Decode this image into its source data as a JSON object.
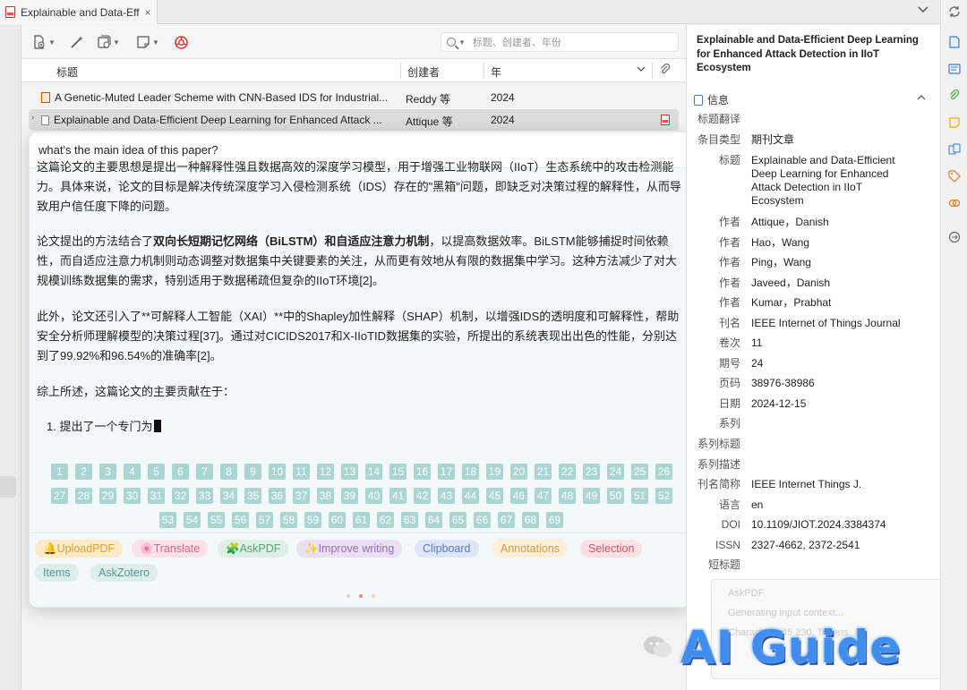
{
  "tab": {
    "title": "Explainable and Data-Eff",
    "close": "×"
  },
  "search": {
    "placeholder": "标题、创建者、年份"
  },
  "columns": {
    "title": "标题",
    "creator": "创建者",
    "year": "年"
  },
  "rows": [
    {
      "title": "A Genetic-Muted Leader Scheme with CNN-Based IDS for Industrial...",
      "creator": "Reddy 等",
      "year": "2024"
    },
    {
      "title": "Explainable and Data-Efficient Deep Learning for Enhanced Attack ...",
      "creator": "Attique 等",
      "year": "2024"
    }
  ],
  "chat": {
    "question": "what's the main idea of this paper?",
    "p0": "这篇论文的主要思想是提出一种解释性强且数据高效的深度学习模型，用于增强工业物联网（IIoT）生态系统中的攻击检测能",
    "p1": "力。具体来说，论文的目标是解决传统深度学习入侵检测系统（IDS）存在的\"黑箱\"问题，即缺乏对决策过程的解释性，从而导致用户信任度下降的问题。",
    "p2_pre": "论文提出的方法结合了",
    "p2_bold": "双向长短期记忆网络（BiLSTM）和自适应注意力机制",
    "p2_post": "，以提高数据效率。BiLSTM能够捕捉时间依赖性，而自适应注意力机制则动态调整对数据集中关键要素的关注，从而更有效地从有限的数据集中学习。这种方法减少了对大规模训练数据集的需求，特别适用于数据稀疏但复杂的IIoT环境[2]。",
    "p3": "此外，论文还引入了**可解释人工智能（XAI）**中的Shapley加性解释（SHAP）机制，以增强IDS的透明度和可解释性，帮助安全分析师理解模型的决策过程[37]。通过对CICIDS2017和X-IIoTID数据集的实验，所提出的系统表现出出色的性能，分别达到了99.92%和96.54%的准确率[2]。",
    "p4": "综上所述，这篇论文的主要贡献在于：",
    "p5": "1. 提出了一个专门为",
    "chips": [
      "🔔UploadPDF",
      "🌸Translate",
      "🧩AskPDF",
      "✨Improve writing",
      "Clipboard",
      "Annotations",
      "Selection",
      "Items",
      "AskZotero"
    ]
  },
  "item": {
    "title": "Explainable and Data-Efficient Deep Learning for Enhanced Attack Detection in IIoT Ecosystem",
    "section": "信息",
    "fields": [
      {
        "label": "标题翻译",
        "value": ""
      },
      {
        "label": "条目类型",
        "value": "期刊文章"
      },
      {
        "label": "标题",
        "value": "Explainable and Data-Efficient Deep Learning for Enhanced Attack Detection in IIoT Ecosystem"
      },
      {
        "label": "作者",
        "value": "Attique，Danish"
      },
      {
        "label": "作者",
        "value": "Hao，Wang"
      },
      {
        "label": "作者",
        "value": "Ping，Wang"
      },
      {
        "label": "作者",
        "value": "Javeed，Danish"
      },
      {
        "label": "作者",
        "value": "Kumar，Prabhat"
      },
      {
        "label": "刊名",
        "value": "IEEE Internet of Things Journal"
      },
      {
        "label": "卷次",
        "value": "11"
      },
      {
        "label": "期号",
        "value": "24"
      },
      {
        "label": "页码",
        "value": "38976-38986"
      },
      {
        "label": "日期",
        "value": "2024-12-15"
      },
      {
        "label": "系列",
        "value": ""
      },
      {
        "label": "系列标题",
        "value": ""
      },
      {
        "label": "系列描述",
        "value": ""
      },
      {
        "label": "刊名简称",
        "value": "IEEE Internet Things J."
      },
      {
        "label": "语言",
        "value": "en"
      },
      {
        "label": "DOI",
        "value": "10.1109/JIOT.2024.3384374"
      },
      {
        "label": "ISSN",
        "value": "2327-4662, 2372-2541"
      },
      {
        "label": "短标题",
        "value": ""
      }
    ]
  },
  "notice": {
    "line1": "AskPDF",
    "line2": "Generating input context...",
    "line3": "Characters: 45 230, Tokens..."
  },
  "watermark": {
    "text": "AI Guide"
  },
  "colors": {
    "chip_teal": "#a9d6d3",
    "accent_blue": "#3b7bd6",
    "zotero_red": "#e0393e"
  }
}
